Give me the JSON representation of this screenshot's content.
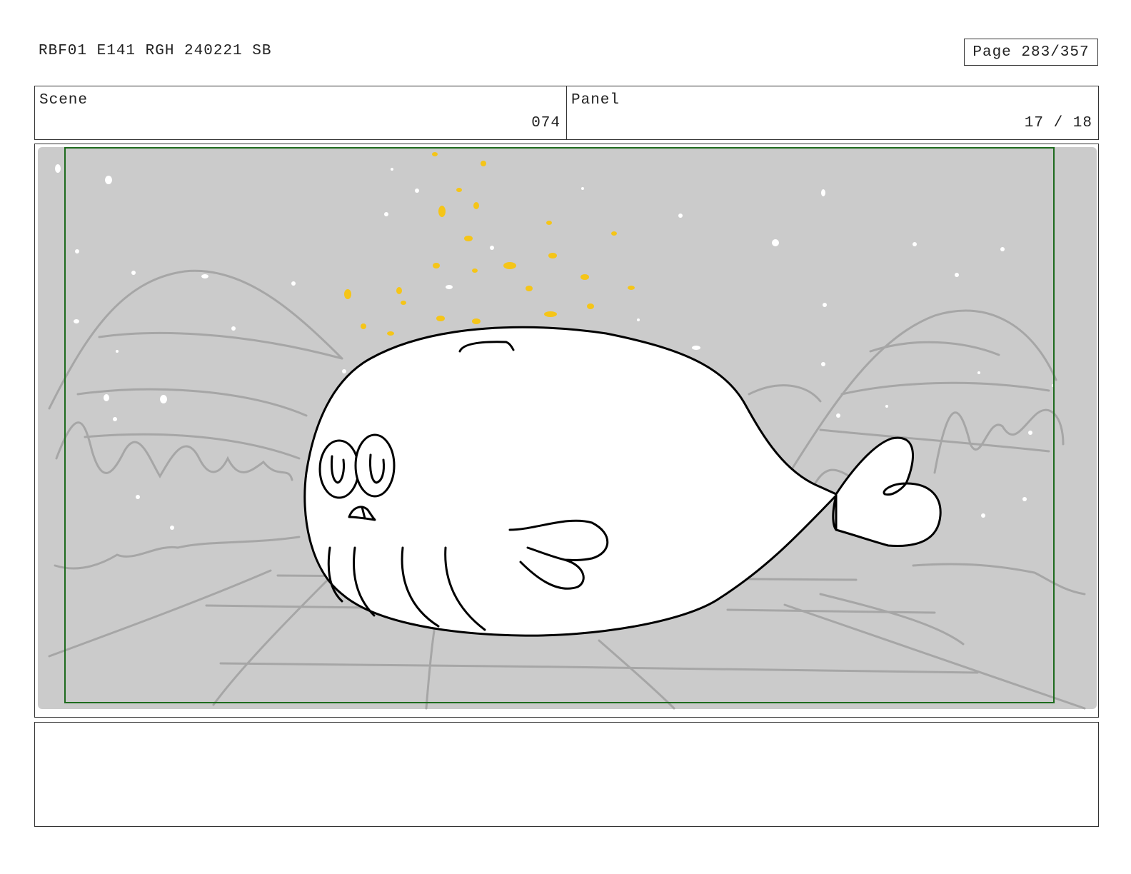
{
  "header": {
    "title": "RBF01 E141 RGH 240221 SB",
    "page": "Page 283/357"
  },
  "scene": {
    "label": "Scene",
    "value": "074"
  },
  "panel": {
    "label": "Panel",
    "value": "17 / 18"
  },
  "illustration": {
    "background_color": "#cbcbcb",
    "safe_frame_color": "#1e6b1e",
    "sparkle_color": "#f5c518"
  },
  "notes": {
    "text": ""
  }
}
